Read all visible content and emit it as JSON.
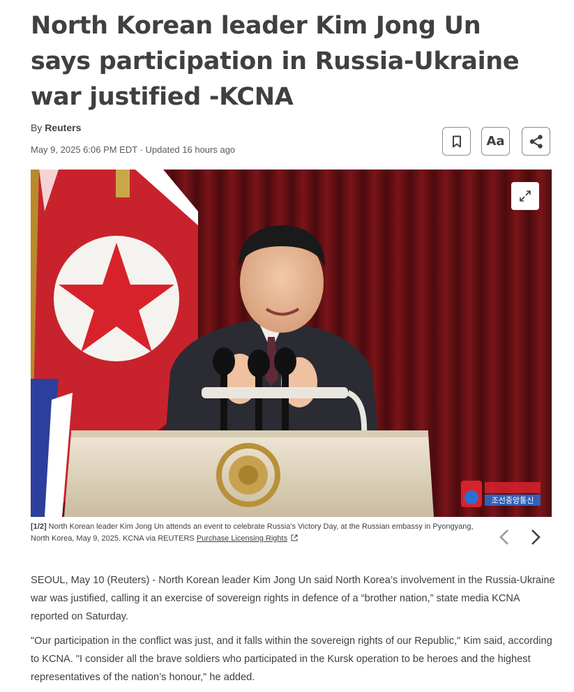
{
  "article": {
    "headline": "North Korean leader Kim Jong Un says participation in Russia-Ukraine war justified -KCNA",
    "byline_prefix": "By ",
    "author": "Reuters",
    "dateline": "May 9, 2025 6:06 PM EDT · Updated 16 hours ago"
  },
  "toolbar": {
    "bookmark_icon": "bookmark-icon",
    "text_size_label": "Aa",
    "share_icon": "share-icon"
  },
  "gallery": {
    "counter": "[1/2]",
    "caption": " North Korean leader Kim Jong Un attends an event to celebrate Russia's Victory Day, at the Russian embassy in Pyongyang, North Korea, May 9, 2025. KCNA via REUTERS ",
    "licensing_link": "Purchase Licensing Rights",
    "expand_icon": "expand-icon",
    "prev_icon": "chevron-left-icon",
    "next_icon": "chevron-right-icon",
    "watermark_text": "조선중앙통신"
  },
  "body": {
    "paragraphs": [
      "SEOUL, May 10 (Reuters) - North Korean leader Kim Jong Un said North Korea’s involvement in the Russia-Ukraine war was justified, calling it an exercise of sovereign rights in defence of a “brother nation,” state media KCNA reported on Saturday.",
      "\"Our participation in the conflict was just, and it falls within the sovereign rights of our Republic,\" Kim said, according to KCNA. \"I consider all the brave soldiers who participated in the Kursk operation to be heroes and the highest representatives of the nation’s honour,\" he added."
    ]
  }
}
